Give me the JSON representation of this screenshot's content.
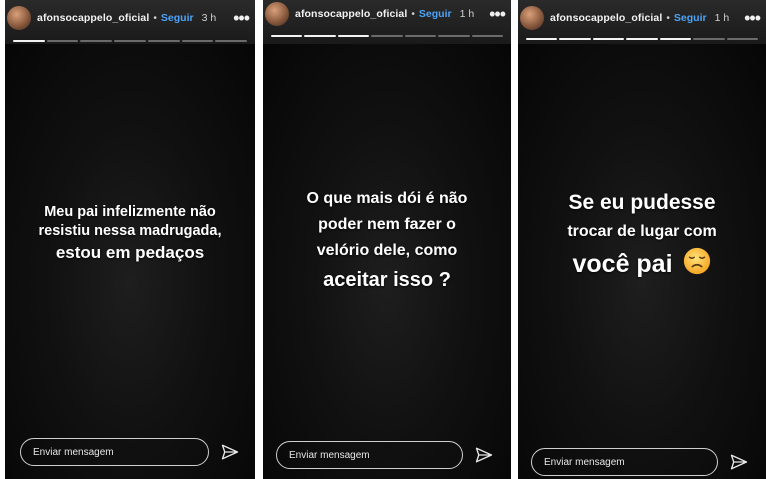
{
  "stories": [
    {
      "username": "afonsocappelo_oficial",
      "dot": "•",
      "follow_label": "Seguir",
      "time": "3 h",
      "more": "•••",
      "caption_lines": [
        "Meu pai infelizmente não",
        "resistiu nessa madrugada,",
        "estou em pedaços"
      ],
      "message_placeholder": "Enviar mensagem",
      "progress_segments": 7,
      "progress_done": 1
    },
    {
      "username": "afonsocappelo_oficial",
      "dot": "•",
      "follow_label": "Seguir",
      "time": "1 h",
      "more": "•••",
      "caption_lines": [
        "O que mais dói é não",
        "poder nem fazer o",
        "velório dele, como",
        "aceitar isso ?"
      ],
      "message_placeholder": "Enviar mensagem",
      "progress_segments": 7,
      "progress_done": 3
    },
    {
      "username": "afonsocappelo_oficial",
      "dot": "•",
      "follow_label": "Seguir",
      "time": "1 h",
      "more": "•••",
      "caption_lines": [
        "Se eu pudesse",
        "trocar de lugar com",
        "você pai"
      ],
      "caption_emoji": "disappointed-face-emoji",
      "message_placeholder": "Enviar mensagem",
      "progress_segments": 7,
      "progress_done": 5
    }
  ],
  "icons": {
    "send": "paper-plane-icon",
    "more": "more-options-icon"
  }
}
